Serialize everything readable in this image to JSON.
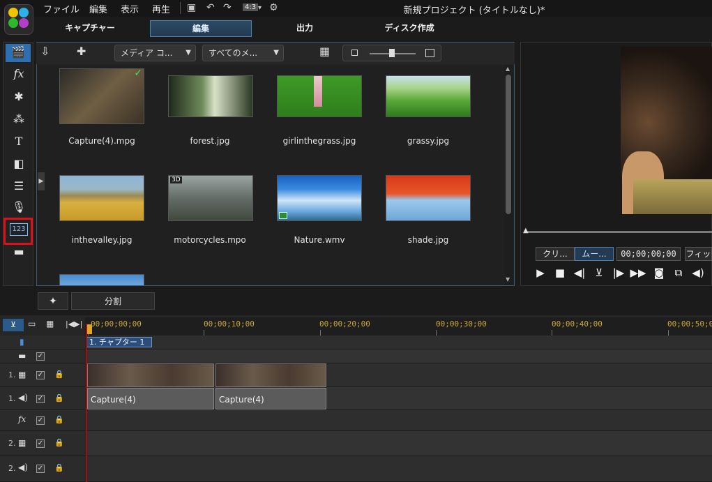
{
  "menu": [
    "ファイル",
    "編集",
    "表示",
    "再生"
  ],
  "toolbar": {
    "aspect": "4:3"
  },
  "app_title": "新規プロジェクト (タイトルなし)*",
  "modes": [
    "キャプチャー",
    "編集",
    "出力",
    "ディスク作成"
  ],
  "library": {
    "filter_media": "メディア コ...",
    "filter_all": "すべてのメ...",
    "items": [
      {
        "label": "Capture(4).mpg",
        "checked": true
      },
      {
        "label": "forest.jpg"
      },
      {
        "label": "girlinthegrass.jpg"
      },
      {
        "label": "grassy.jpg"
      },
      {
        "label": "inthevalley.jpg"
      },
      {
        "label": "motorcycles.mpo",
        "badge": "3D"
      },
      {
        "label": "Nature.wmv"
      },
      {
        "label": "shade.jpg"
      }
    ]
  },
  "preview": {
    "clip_btn": "クリ...",
    "movie_btn": "ムー...",
    "timecode": "00;00;00;00",
    "fit_btn": "フィッ"
  },
  "split_label": "分割",
  "timeline": {
    "ruler": [
      "00;00;00;00",
      "00;00;10;00",
      "00;00;20;00",
      "00;00;30;00",
      "00;00;40;00",
      "00;00;50;0"
    ],
    "chapter": "1. チャプター 1",
    "track_numbers": [
      "1.",
      "1.",
      "2.",
      "2."
    ],
    "clips": [
      "Capture(4)",
      "Capture(4)"
    ]
  }
}
